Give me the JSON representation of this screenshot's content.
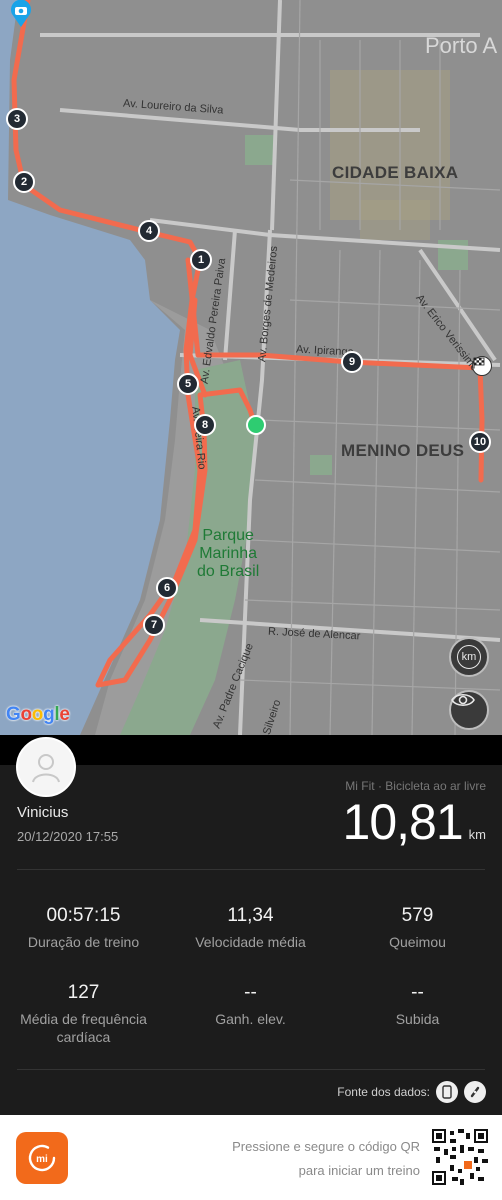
{
  "map": {
    "labels": {
      "city": "Porto A",
      "district_cidade_baixa": "CIDADE BAIXA",
      "district_menino_deus": "MENINO DEUS",
      "street_loureiro": "Av. Loureiro da Silva",
      "street_erico": "Av. Erico Verissimo",
      "street_ipiranga": "Av. Ipiranga",
      "street_borges": "Av. Borges de Medeiros",
      "street_edvaldo": "Av. Edvaldo Pereira Paiva",
      "street_beira_rio": "Av. Beira Rio",
      "street_jose_alencar": "R. José de Alencar",
      "street_padre_cacique": "Av. Padre Cacique",
      "street_silveiro": "R. Silveiro",
      "park_line1": "Parque",
      "park_line2": "Marinha",
      "park_line3": "do Brasil"
    },
    "km_markers": [
      "1",
      "2",
      "3",
      "4",
      "5",
      "6",
      "7",
      "8",
      "9",
      "10"
    ],
    "buttons": {
      "unit_toggle": "km",
      "view_toggle": "eye-icon"
    },
    "attribution": "Google",
    "colors": {
      "route": "#f26b4e",
      "start": "#2ecc71",
      "marker": "#222a33"
    }
  },
  "workout": {
    "user_name": "Vinicius",
    "datetime": "20/12/2020 17:55",
    "source_type": "Mi Fit · Bicicleta ao ar livre",
    "distance_value": "10,81",
    "distance_unit": "km"
  },
  "stats": [
    {
      "value": "00:57:15",
      "label": "Duração de treino"
    },
    {
      "value": "11,34",
      "label": "Velocidade média"
    },
    {
      "value": "579",
      "label": "Queimou"
    },
    {
      "value": "127",
      "label": "Média de frequência cardíaca"
    },
    {
      "value": "--",
      "label": "Ganh. elev."
    },
    {
      "value": "--",
      "label": "Subida"
    }
  ],
  "data_source": {
    "label": "Fonte dos dados:",
    "icons": [
      "phone-icon",
      "band-icon"
    ]
  },
  "footer": {
    "logo": "mi",
    "qr_line1": "Pressione e segure o código QR",
    "qr_line2": "para iniciar um treino"
  }
}
